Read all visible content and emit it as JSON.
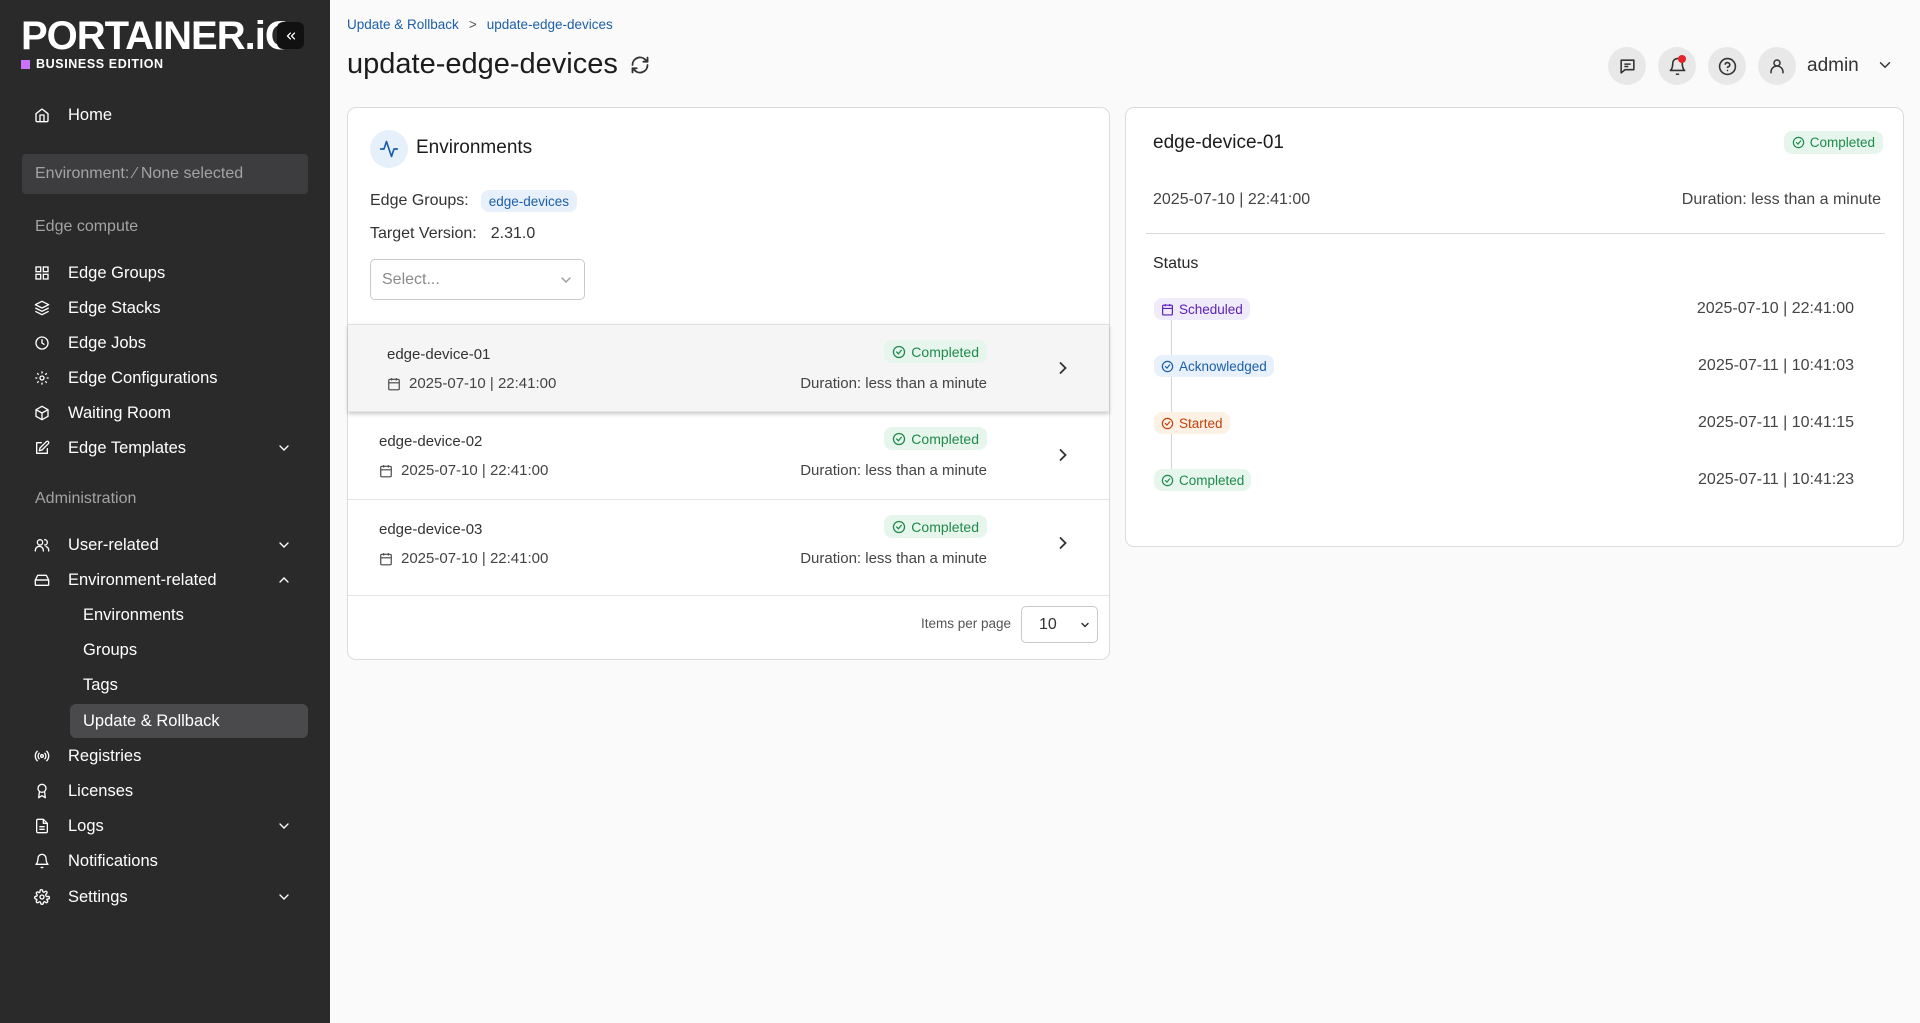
{
  "sidebar": {
    "logo_main": "PORTAINER.iO",
    "logo_sub": "BUSINESS EDITION",
    "home": "Home",
    "environment_selector": "Environment: ⁄ None selected",
    "edge_compute_label": "Edge compute",
    "edge_items": [
      "Edge Groups",
      "Edge Stacks",
      "Edge Jobs",
      "Edge Configurations",
      "Waiting Room",
      "Edge Templates"
    ],
    "administration_label": "Administration",
    "user_related": "User-related",
    "environment_related": "Environment-related",
    "environment_subitems": [
      "Environments",
      "Groups",
      "Tags",
      "Update & Rollback"
    ],
    "bottom_items": [
      "Registries",
      "Licenses",
      "Logs",
      "Notifications",
      "Settings"
    ]
  },
  "header": {
    "breadcrumb": [
      "Update & Rollback",
      "update-edge-devices"
    ],
    "breadcrumb_sep": ">",
    "title": "update-edge-devices",
    "user": "admin"
  },
  "environments_panel": {
    "title": "Environments",
    "edge_groups_label": "Edge Groups:",
    "edge_group_tag": "edge-devices",
    "target_version_label": "Target Version:",
    "target_version": "2.31.0",
    "select_placeholder": "Select...",
    "rows": [
      {
        "name": "edge-device-01",
        "date": "2025-07-10 | 22:41:00",
        "status": "Completed",
        "duration": "Duration: less than a minute"
      },
      {
        "name": "edge-device-02",
        "date": "2025-07-10 | 22:41:00",
        "status": "Completed",
        "duration": "Duration: less than a minute"
      },
      {
        "name": "edge-device-03",
        "date": "2025-07-10 | 22:41:00",
        "status": "Completed",
        "duration": "Duration: less than a minute"
      }
    ],
    "items_per_page_label": "Items per page",
    "items_per_page": "10"
  },
  "detail_panel": {
    "device": "edge-device-01",
    "status": "Completed",
    "date": "2025-07-10 | 22:41:00",
    "duration": "Duration: less than a minute",
    "status_label": "Status",
    "timeline": [
      {
        "label": "Scheduled",
        "time": "2025-07-10 | 22:41:00"
      },
      {
        "label": "Acknowledged",
        "time": "2025-07-11 | 10:41:03"
      },
      {
        "label": "Started",
        "time": "2025-07-11 | 10:41:15"
      },
      {
        "label": "Completed",
        "time": "2025-07-11 | 10:41:23"
      }
    ]
  },
  "colors": {
    "sidebar_bg": "#2a2a2b",
    "accent_blue": "#1c5fa8",
    "success_green": "#1f8a4c",
    "brand_purple": "#c873f9"
  },
  "icons": [
    "chevrons-left-icon",
    "home-icon",
    "grid-icon",
    "layers-icon",
    "clock-icon",
    "settings-cog-icon",
    "box-icon",
    "edit-icon",
    "chevron-down-icon",
    "chevron-up-icon",
    "user-icon",
    "hard-drive-icon",
    "radio-icon",
    "award-icon",
    "file-text-icon",
    "bell-icon",
    "gear-icon",
    "refresh-icon",
    "chat-icon",
    "help-icon",
    "activity-icon",
    "calendar-icon",
    "check-circle-icon",
    "chevron-right-icon"
  ]
}
